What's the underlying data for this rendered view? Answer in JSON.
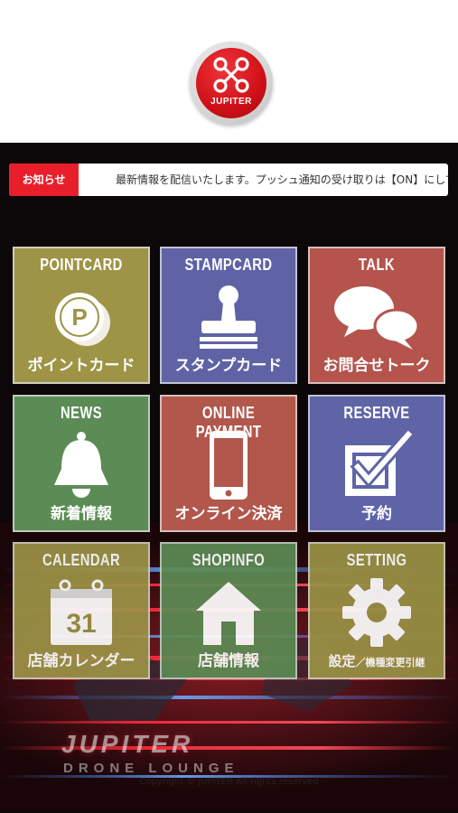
{
  "app": {
    "logo_text": "JUPITER"
  },
  "notice": {
    "badge": "お知らせ",
    "text": "最新情報を配信いたします。プッシュ通知の受け取りは【ON】にしてください。"
  },
  "tiles": [
    {
      "title": "POINTCARD",
      "label": "ポイントカード",
      "icon": "point-coin-icon",
      "color": "#9d9446"
    },
    {
      "title": "STAMPCARD",
      "label": "スタンプカード",
      "icon": "stamp-icon",
      "color": "#5f63a5"
    },
    {
      "title": "TALK",
      "label": "お問合せトーク",
      "icon": "chat-bubbles-icon",
      "color": "#b4544c"
    },
    {
      "title": "NEWS",
      "label": "新着情報",
      "icon": "bell-icon",
      "color": "#5b8c55"
    },
    {
      "title": "ONLINE PAYMENT",
      "label": "オンライン決済",
      "icon": "smartphone-icon",
      "color": "#b2574c"
    },
    {
      "title": "RESERVE",
      "label": "予約",
      "icon": "checkbox-icon",
      "color": "#5e64a6"
    },
    {
      "title": "CALENDAR",
      "label": "店舗カレンダー",
      "icon": "calendar-icon",
      "color": "#9c9347",
      "calendar_day": "31"
    },
    {
      "title": "SHOPINFO",
      "label": "店舗情報",
      "icon": "house-icon",
      "color": "#5c8b54"
    },
    {
      "title": "SETTING",
      "label_main": "設定",
      "label_sub": "／機種変更引継",
      "icon": "gear-icon",
      "color": "#9a9245"
    }
  ],
  "footer": {
    "brand": "JUPITER",
    "brand_sub": "DRONE LOUNGE",
    "copyright": "Copyright © JUPITER All rights reserved"
  }
}
